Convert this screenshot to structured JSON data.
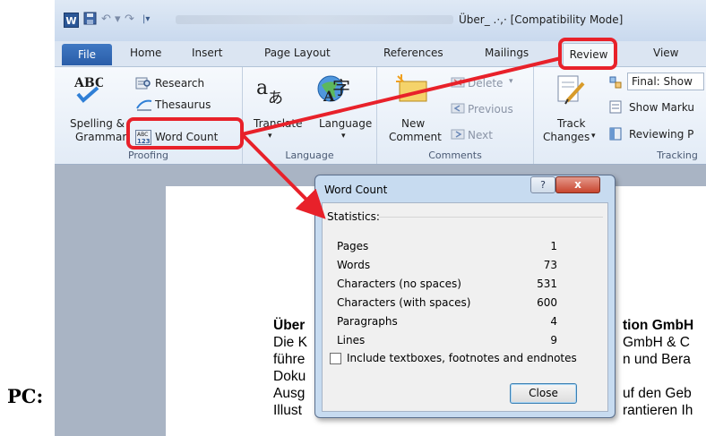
{
  "pc_label": "PC:",
  "window": {
    "logo": "W",
    "title_suffix": "Über_ .·,·  [Compatibility Mode]",
    "qat": {
      "save_icon": "save-icon",
      "undo_icon": "undo-icon",
      "redo_icon": "redo-icon"
    }
  },
  "tabs": {
    "file": "File",
    "home": "Home",
    "insert": "Insert",
    "page_layout": "Page Layout",
    "references": "References",
    "mailings": "Mailings",
    "review": "Review",
    "view": "View"
  },
  "ribbon": {
    "proofing": {
      "label": "Proofing",
      "spelling_line1": "Spelling &",
      "spelling_line2": "Grammar",
      "research": "Research",
      "thesaurus": "Thesaurus",
      "word_count": "Word Count"
    },
    "language": {
      "label": "Language",
      "translate": "Translate",
      "language": "Language"
    },
    "comments": {
      "label": "Comments",
      "new_line1": "New",
      "new_line2": "Comment",
      "delete": "Delete",
      "previous": "Previous",
      "next": "Next"
    },
    "tracking": {
      "label": "Tracking",
      "track_line1": "Track",
      "track_line2": "Changes",
      "final_show": "Final: Show",
      "show_markup": "Show Marku",
      "reviewing_pane": "Reviewing P"
    }
  },
  "document": {
    "lines": [
      "Über",
      "Die K",
      "führe",
      "Doku",
      "Ausg",
      "Illust"
    ],
    "right_lines": [
      "tion GmbH",
      "GmbH & C",
      "n und Bera",
      "",
      "uf den Geb",
      "rantieren Ih"
    ]
  },
  "dialog": {
    "title": "Word Count",
    "help": "?",
    "close_x": "x",
    "statistics_header": "Statistics:",
    "stats": [
      {
        "label": "Pages",
        "value": "1"
      },
      {
        "label": "Words",
        "value": "73"
      },
      {
        "label": "Characters (no spaces)",
        "value": "531"
      },
      {
        "label": "Characters (with spaces)",
        "value": "600"
      },
      {
        "label": "Paragraphs",
        "value": "4"
      },
      {
        "label": "Lines",
        "value": "9"
      }
    ],
    "checkbox_label": "Include textboxes, footnotes and endnotes",
    "checkbox_checked": false,
    "close_button": "Close"
  },
  "colors": {
    "annotation": "#e8212a",
    "file_tab": "#2a5da8",
    "dialog_frame": "#c7dbf0"
  }
}
